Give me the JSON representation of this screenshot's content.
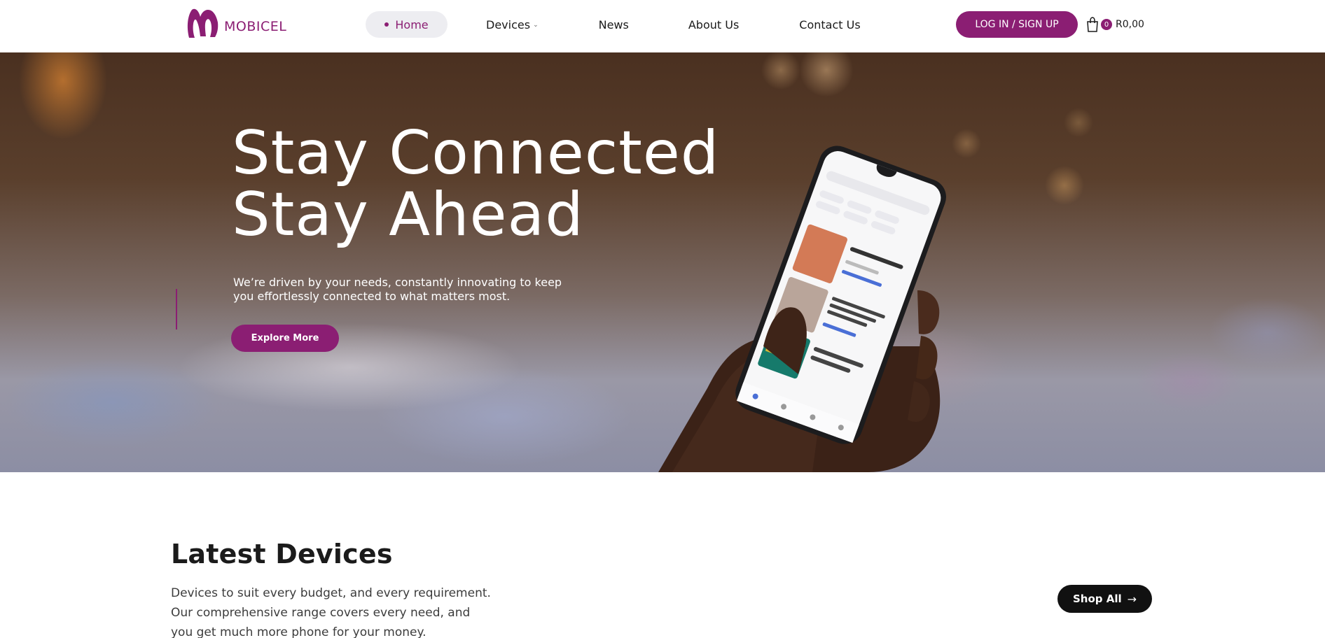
{
  "header": {
    "logo_text": "MOBICEL",
    "nav": [
      {
        "label": "Home",
        "active": true
      },
      {
        "label": "Devices",
        "has_dropdown": true
      },
      {
        "label": "News"
      },
      {
        "label": "About Us"
      },
      {
        "label": "Contact Us"
      }
    ],
    "login_label": "LOG IN / SIGN UP",
    "cart_count": "0",
    "cart_total": "R0,00"
  },
  "hero": {
    "title_line1": "Stay Connected",
    "title_line2": "Stay Ahead",
    "description": "We’re driven by your needs, constantly innovating to keep you effortlessly connected to what matters most.",
    "cta_label": "Explore More"
  },
  "latest": {
    "title": "Latest Devices",
    "description": "Devices to suit every budget, and every requirement. Our comprehensive range covers every need, and you get much more phone for your money.",
    "shop_label": "Shop All"
  },
  "colors": {
    "brand": "#8b1e73",
    "dark": "#111111",
    "nav_pill": "#ededf1"
  },
  "icons": {
    "cart": "shopping-bag-icon",
    "shop_arrow": "arrow-right-icon",
    "dropdown": "chevron-down-icon"
  }
}
